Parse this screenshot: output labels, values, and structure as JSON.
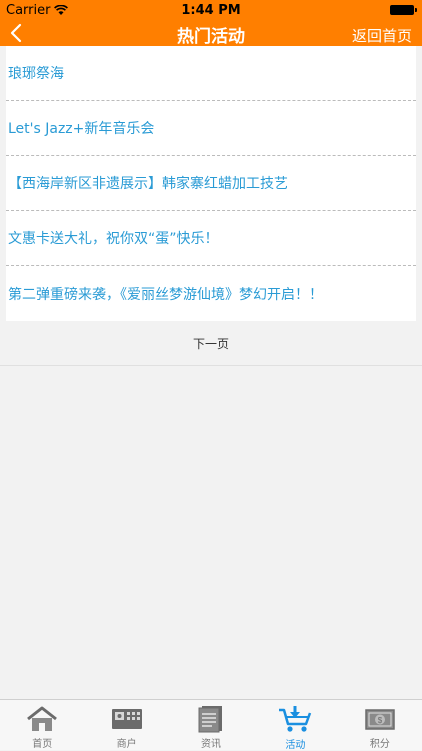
{
  "status_bar": {
    "carrier": "Carrier",
    "time": "1:44 PM"
  },
  "nav": {
    "title": "热门活动",
    "home_link": "返回首页"
  },
  "activities": [
    "琅琊祭海",
    "Let's Jazz+新年音乐会",
    "【西海岸新区非遗展示】韩家寨红蜡加工技艺",
    "文惠卡送大礼，祝你双“蛋”快乐！",
    "第二弹重磅来袭，《爱丽丝梦游仙境》梦幻开启！！"
  ],
  "pagination": {
    "next_label": "下一页"
  },
  "tabs": [
    {
      "label": "首页",
      "icon": "home-icon",
      "active": false
    },
    {
      "label": "商户",
      "icon": "merchant-icon",
      "active": false
    },
    {
      "label": "资讯",
      "icon": "news-icon",
      "active": false
    },
    {
      "label": "活动",
      "icon": "activity-cart-icon",
      "active": true
    },
    {
      "label": "积分",
      "icon": "points-icon",
      "active": false
    }
  ],
  "colors": {
    "brand": "#ff7f00",
    "link": "#2a9bd5",
    "tab_active": "#1a8fe0"
  }
}
